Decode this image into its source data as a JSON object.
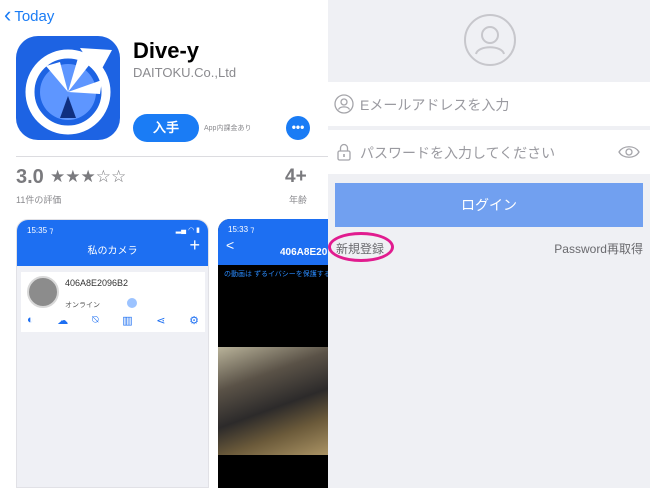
{
  "appstore": {
    "back_label": "Today",
    "app_name": "Dive-y",
    "developer": "DAITOKU.Co.,Ltd",
    "get_label": "入手",
    "iap_note": "App内課金あり",
    "more_label": "•••",
    "rating": "3.0",
    "stars": "★★★☆☆",
    "rating_count": "11件の評価",
    "age": "4+",
    "age_label": "年齢"
  },
  "screenshot1": {
    "time": "15:35 ⁊",
    "signal": "▂▄ ◠ ▮",
    "title": "私のカメラ",
    "add": "+",
    "camera_id": "406A8E2096B2",
    "status": "オンライン"
  },
  "screenshot2": {
    "time": "15:33 ⁊",
    "back": "<",
    "camera_id": "406A8E20",
    "notice": "の動画は ずるイバシーを保護する"
  },
  "login": {
    "email_placeholder": "Eメールアドレスを入力",
    "password_placeholder": "パスワードを入力してください",
    "login_label": "ログイン",
    "register_label": "新規登録",
    "reset_label": "Password再取得"
  },
  "colors": {
    "accent": "#1a7cf5",
    "login_button": "#71a0f0",
    "annotation": "#e11c8f"
  }
}
